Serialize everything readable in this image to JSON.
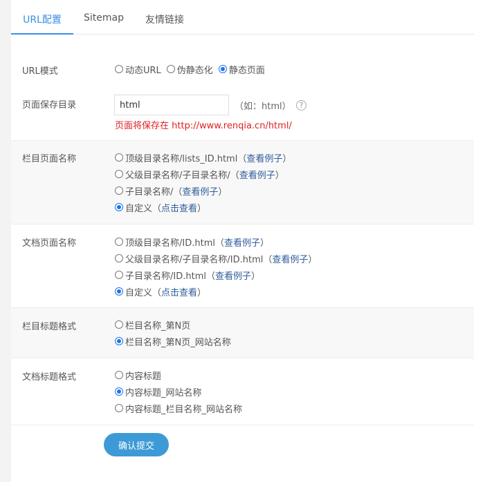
{
  "tabs": [
    {
      "label": "URL配置",
      "active": true
    },
    {
      "label": "Sitemap",
      "active": false
    },
    {
      "label": "友情链接",
      "active": false
    }
  ],
  "url_mode": {
    "label": "URL模式",
    "options": [
      {
        "text": "动态URL",
        "checked": false
      },
      {
        "text": "伪静态化",
        "checked": false
      },
      {
        "text": "静态页面",
        "checked": true
      }
    ]
  },
  "save_dir": {
    "label": "页面保存目录",
    "value": "html",
    "hint": "（如：html）",
    "notice": "页面将保存在 http://www.renqia.cn/html/"
  },
  "column_page_name": {
    "label": "栏目页面名称",
    "options": [
      {
        "text": "顶级目录名称/lists_ID.html",
        "link": "查看例子",
        "checked": false
      },
      {
        "text": "父级目录名称/子目录名称/",
        "link": "查看例子",
        "checked": false
      },
      {
        "text": "子目录名称/",
        "link": "查看例子",
        "checked": false
      },
      {
        "text": "自定义",
        "link": "点击查看",
        "checked": true
      }
    ]
  },
  "doc_page_name": {
    "label": "文档页面名称",
    "options": [
      {
        "text": "顶级目录名称/ID.html",
        "link": "查看例子",
        "checked": false
      },
      {
        "text": "父级目录名称/子目录名称/ID.html",
        "link": "查看例子",
        "checked": false
      },
      {
        "text": "子目录名称/ID.html",
        "link": "查看例子",
        "checked": false
      },
      {
        "text": "自定义",
        "link": "点击查看",
        "checked": true
      }
    ]
  },
  "column_title_format": {
    "label": "栏目标题格式",
    "options": [
      {
        "text": "栏目名称_第N页",
        "checked": false
      },
      {
        "text": "栏目名称_第N页_网站名称",
        "checked": true
      }
    ]
  },
  "doc_title_format": {
    "label": "文档标题格式",
    "options": [
      {
        "text": "内容标题",
        "checked": false
      },
      {
        "text": "内容标题_网站名称",
        "checked": true
      },
      {
        "text": "内容标题_栏目名称_网站名称",
        "checked": false
      }
    ]
  },
  "submit_label": "确认提交",
  "colors": {
    "accent": "#3a8ee6",
    "button": "#3d9ad6",
    "notice": "#e02020",
    "link": "#2e5d9c"
  }
}
